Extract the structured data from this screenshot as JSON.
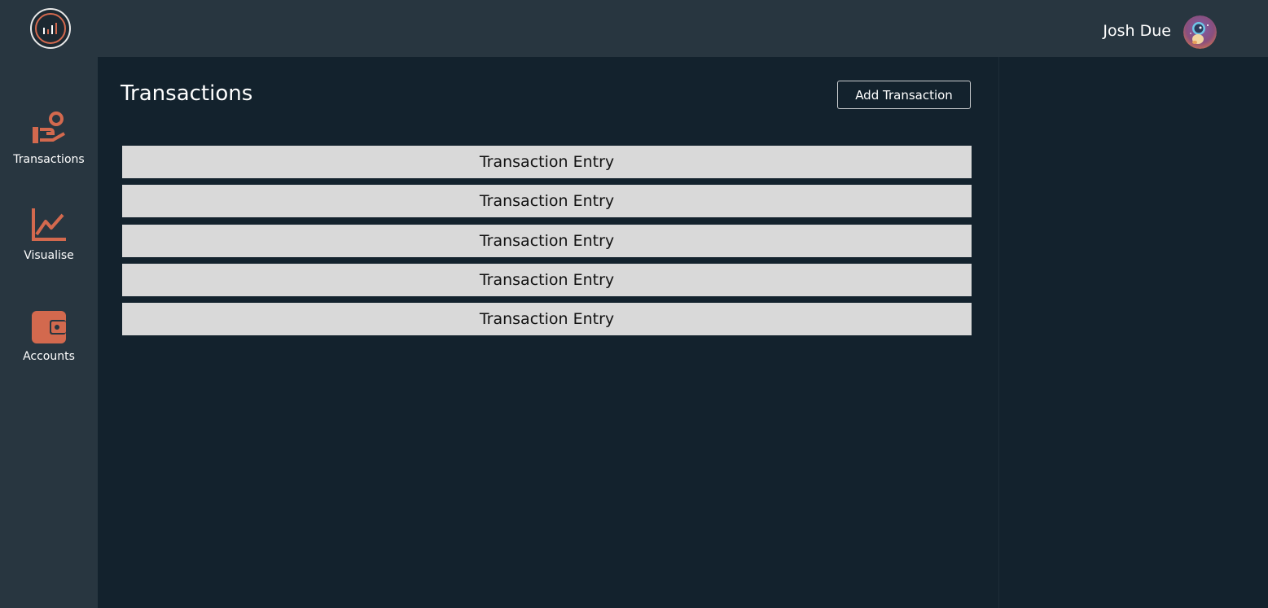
{
  "sidebar": {
    "logo": {
      "icon": "bar-chart-logo-icon"
    },
    "items": [
      {
        "label": "Transactions",
        "icon": "hand-coin-icon"
      },
      {
        "label": "Visualise",
        "icon": "line-chart-icon"
      },
      {
        "label": "Accounts",
        "icon": "wallet-icon"
      }
    ]
  },
  "header": {
    "user_name": "Josh Due",
    "avatar": "user-avatar"
  },
  "main": {
    "title": "Transactions",
    "add_button_label": "Add Transaction",
    "transactions": [
      {
        "label": "Transaction Entry"
      },
      {
        "label": "Transaction Entry"
      },
      {
        "label": "Transaction Entry"
      },
      {
        "label": "Transaction Entry"
      },
      {
        "label": "Transaction Entry"
      }
    ]
  },
  "colors": {
    "accent": "#d3694e",
    "sidebar_bg": "#283640",
    "main_bg": "#13222d",
    "row_bg": "#d9d9d9"
  }
}
